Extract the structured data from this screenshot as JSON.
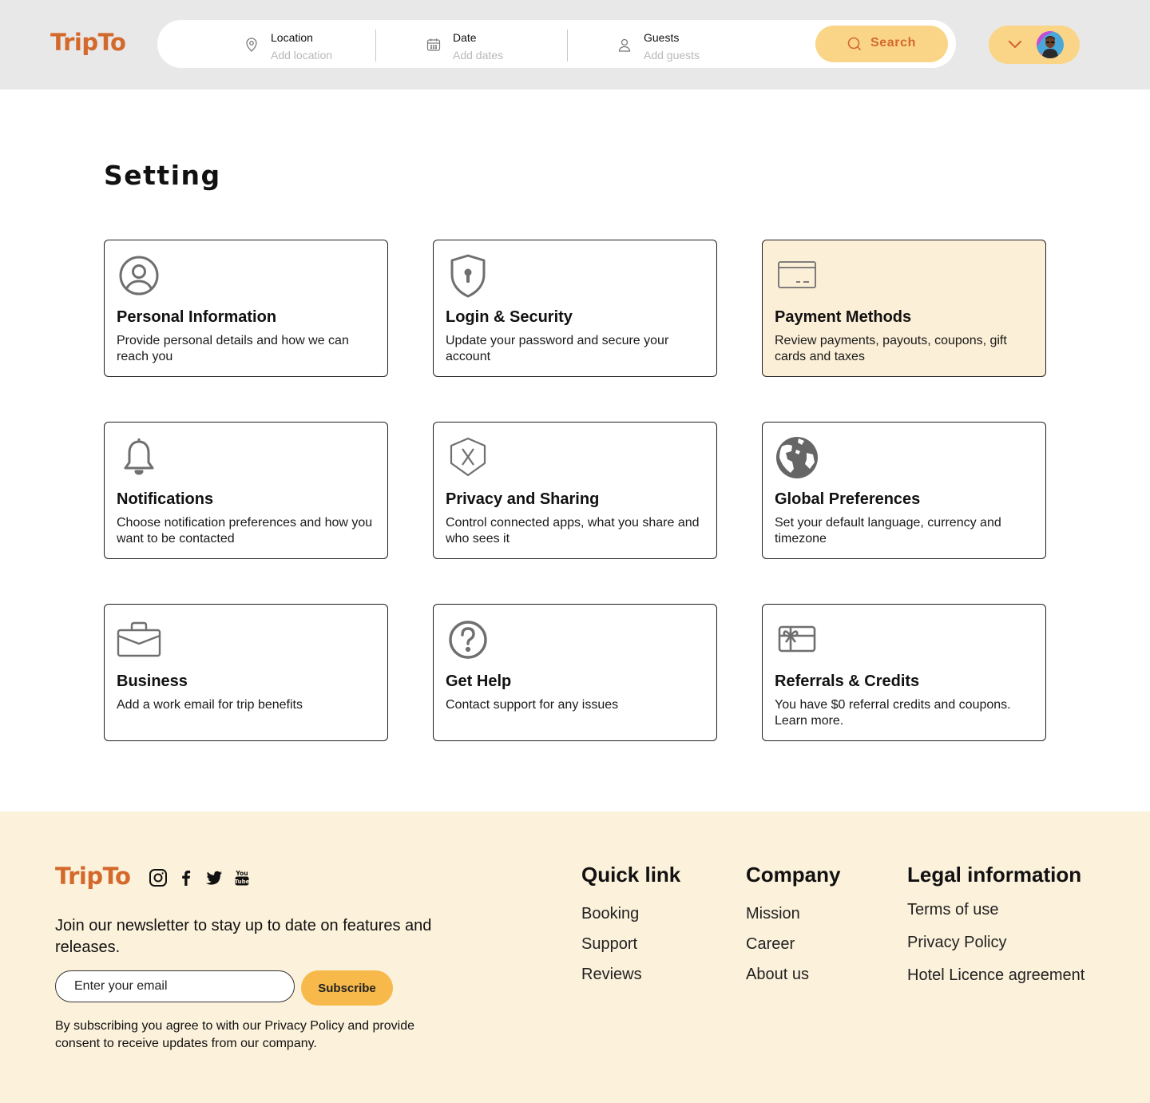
{
  "header": {
    "logo": "TripTo",
    "search": {
      "location_label": "Location",
      "location_placeholder": "Add location",
      "date_label": "Date",
      "date_placeholder": "Add dates",
      "guests_label": "Guests",
      "guests_placeholder": "Add guests",
      "button_label": "Search"
    }
  },
  "main": {
    "title": "Setting",
    "cards": [
      {
        "title": "Personal Information",
        "desc": "Provide personal details and how we can reach you",
        "icon": "user-circle-icon"
      },
      {
        "title": "Login & Security",
        "desc": "Update your password and secure your account",
        "icon": "shield-keyhole-icon"
      },
      {
        "title": "Payment Methods",
        "desc": "Review payments, payouts, coupons, gift cards and taxes",
        "icon": "credit-card-icon"
      },
      {
        "title": "Notifications",
        "desc": "Choose notification preferences and how you want to be contacted",
        "icon": "bell-icon"
      },
      {
        "title": "Privacy and Sharing",
        "desc": "Control connected apps, what you share and who sees it",
        "icon": "shield-x-icon"
      },
      {
        "title": "Global Preferences",
        "desc": "Set your default language, currency and timezone",
        "icon": "globe-icon"
      },
      {
        "title": "Business",
        "desc": "Add a work email for trip benefits",
        "icon": "briefcase-icon"
      },
      {
        "title": "Get Help",
        "desc": "Contact support for any issues",
        "icon": "question-circle-icon"
      },
      {
        "title": "Referrals & Credits",
        "desc": "You have $0 referral credits and coupons. Learn more.",
        "icon": "gift-card-icon"
      }
    ]
  },
  "footer": {
    "logo": "TripTo",
    "newsletter_text": "Join our newsletter to stay up to date on features and releases.",
    "email_placeholder": "Enter your email",
    "subscribe_label": "Subscribe",
    "consent_text": "By subscribing you agree to with our Privacy Policy and provide consent to receive updates from our company.",
    "quick_link": {
      "heading": "Quick link",
      "links": [
        "Booking",
        "Support",
        "Reviews"
      ]
    },
    "company": {
      "heading": "Company",
      "links": [
        "Mission",
        "Career",
        "About us"
      ]
    },
    "legal": {
      "heading": "Legal information",
      "links": [
        "Terms of use",
        "Privacy Policy",
        "Hotel Licence agreement"
      ]
    }
  },
  "colors": {
    "brand": "#d4692c",
    "accent": "#fad588",
    "header_bg": "#e8e8e8",
    "footer_bg": "#fcf1db",
    "active_card_bg": "#fcefd7",
    "subscribe_bg": "#f6b94a"
  }
}
